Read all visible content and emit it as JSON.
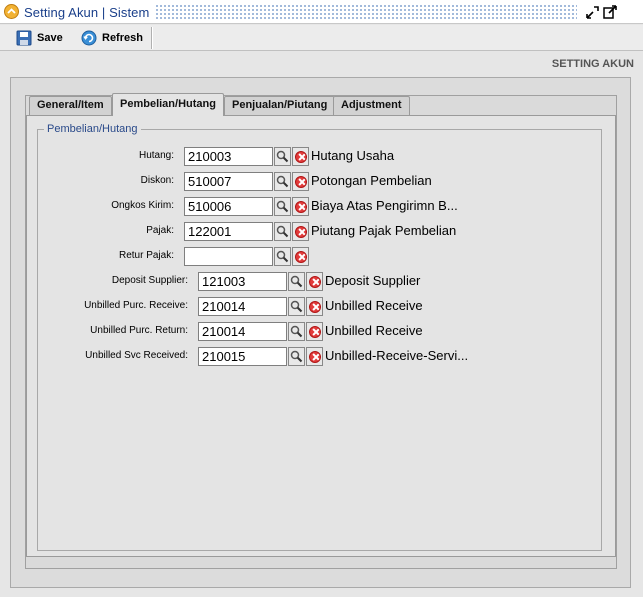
{
  "window": {
    "title": "Setting Akun | Sistem",
    "controls": [
      "restore-icon",
      "maximize-icon"
    ]
  },
  "toolbar": {
    "save_label": "Save",
    "refresh_label": "Refresh"
  },
  "page": {
    "heading": "SETTING AKUN"
  },
  "tabs": [
    {
      "label": "General/Item",
      "active": false
    },
    {
      "label": "Pembelian/Hutang",
      "active": true
    },
    {
      "label": "Penjualan/Piutang",
      "active": false
    },
    {
      "label": "Adjustment",
      "active": false
    }
  ],
  "group": {
    "title": "Pembelian/Hutang"
  },
  "fields": [
    {
      "label": "Hutang:",
      "value": "210003",
      "description": "Hutang Usaha"
    },
    {
      "label": "Diskon:",
      "value": "510007",
      "description": "Potongan Pembelian"
    },
    {
      "label": "Ongkos Kirim:",
      "value": "510006",
      "description": "Biaya Atas Pengirimn B..."
    },
    {
      "label": "Pajak:",
      "value": "122001",
      "description": "Piutang Pajak Pembelian"
    },
    {
      "label": "Retur Pajak:",
      "value": "",
      "description": ""
    },
    {
      "label": "Deposit Supplier:",
      "value": "121003",
      "description": "Deposit Supplier"
    },
    {
      "label": "Unbilled Purc. Receive:",
      "value": "210014",
      "description": "Unbilled Receive"
    },
    {
      "label": "Unbilled Purc. Return:",
      "value": "210014",
      "description": "Unbilled Receive"
    },
    {
      "label": "Unbilled Svc Received:",
      "value": "210015",
      "description": "Unbilled-Receive-Servi..."
    }
  ]
}
